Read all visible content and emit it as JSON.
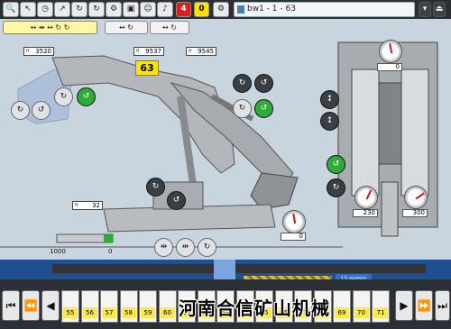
{
  "toolbar": {
    "icons": [
      "magnifier-icon",
      "pointer-icon",
      "clock-icon",
      "cursor-icon",
      "unit-icon",
      "unit-icon",
      "unit-icon",
      "unit-icon"
    ],
    "alarm_red": "4",
    "alarm_yellow": "0",
    "window_title": "bw1 - 1 - 63"
  },
  "readouts": {
    "boom_left": "3520",
    "boom_mid": "9537",
    "boom_right": "9545",
    "arm": "32",
    "unit_label": "ft"
  },
  "machine_number": "63",
  "gauges": {
    "top_right": "0",
    "cylinder_left": "230",
    "cylinder_right": "300",
    "lower": "0"
  },
  "scale": {
    "left": "1000",
    "right": "0"
  },
  "status": {
    "speed": "15 m/min"
  },
  "timeline": {
    "cells": [
      "55",
      "56",
      "57",
      "58",
      "59",
      "60",
      "61",
      "62",
      "63",
      "64",
      "65",
      "66",
      "67",
      "68",
      "69",
      "70",
      "71"
    ]
  },
  "watermark": "河南合信矿山机械",
  "colors": {
    "accent": "#ffe84a",
    "alarm": "#d62020",
    "ok": "#2fab3a",
    "strip": "#1f4f90"
  }
}
